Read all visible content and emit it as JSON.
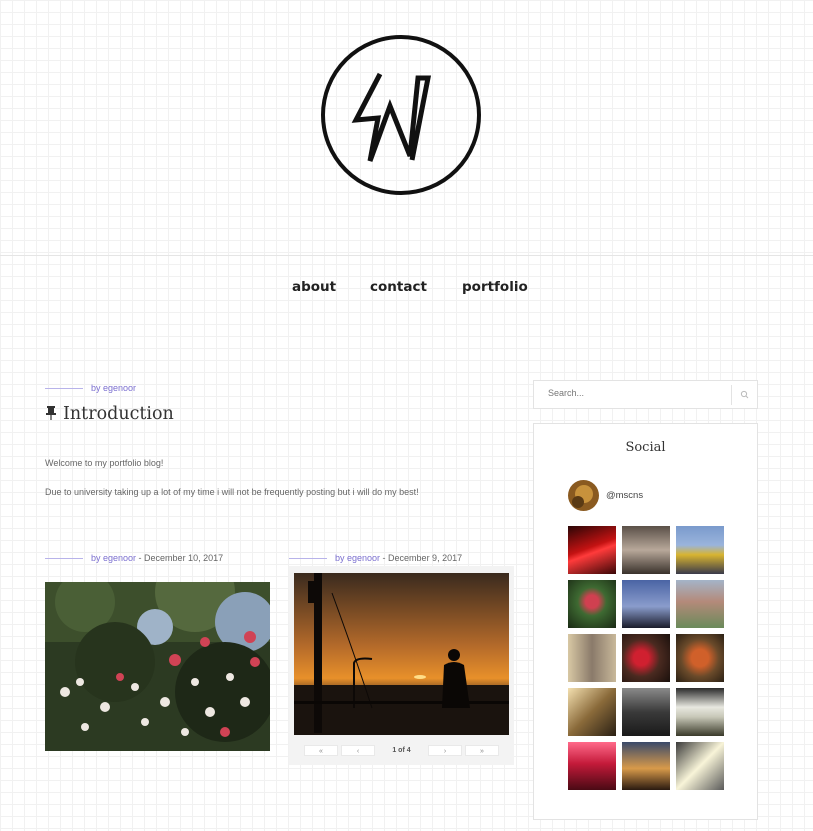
{
  "header": {
    "logo_icon": "circle-w-logo"
  },
  "nav": {
    "items": [
      "about",
      "contact",
      "portfolio"
    ]
  },
  "intro_post": {
    "author": "by egenoor",
    "pin_icon": "pushpin-icon",
    "title": "Introduction",
    "paragraphs": [
      "Welcome to my portfolio blog!",
      "Due to university taking up a lot of my time i will not be frequently posting but i will do my best!"
    ]
  },
  "posts": [
    {
      "author": "by egenoor",
      "date": " - December 10, 2017",
      "image": "flowers-photo"
    },
    {
      "author": "by egenoor",
      "date": " - December 9, 2017",
      "image": "sunset-silhouette-photo"
    }
  ],
  "slider": {
    "first": "«",
    "prev": "‹",
    "count": "1 of 4",
    "next": "›",
    "last": "»"
  },
  "sidebar": {
    "search_placeholder": "Search...",
    "search_icon": "search-icon",
    "widget_title": "Social",
    "instagram_handle": "@mscns",
    "thumbnail_count": 15
  },
  "colors": {
    "accent": "#7b6fd0",
    "accent_rule": "#b8b3ea",
    "text": "#444444"
  }
}
